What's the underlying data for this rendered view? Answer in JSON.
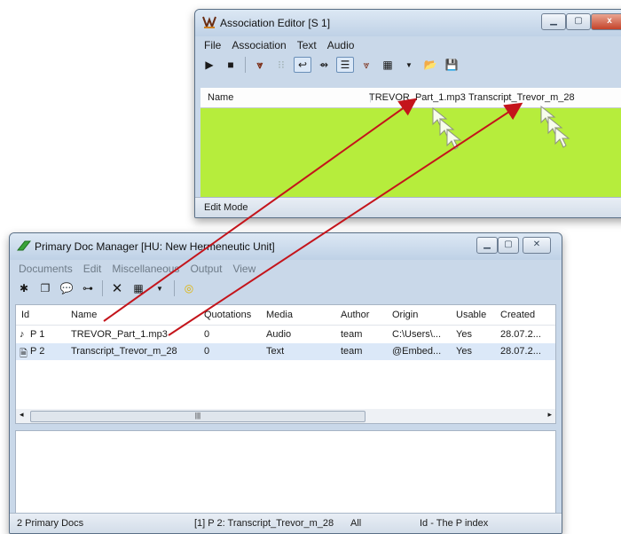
{
  "assoc": {
    "title": "Association Editor [S 1]",
    "menu": [
      "File",
      "Association",
      "Text",
      "Audio"
    ],
    "header": {
      "name": "Name",
      "col1": "TREVOR_Part_1.mp3",
      "col2": "Transcript_Trevor_m_28"
    },
    "status": "Edit Mode"
  },
  "pdm": {
    "title": "Primary Doc Manager [HU: New Hermeneutic Unit]",
    "menu": [
      "Documents",
      "Edit",
      "Miscellaneous",
      "Output",
      "View"
    ],
    "columns": [
      "Id",
      "Name",
      "Quotations",
      "Media",
      "Author",
      "Origin",
      "Usable",
      "Created"
    ],
    "rows": [
      {
        "id": "P 1",
        "name": "TREVOR_Part_1.mp3",
        "quotations": "0",
        "media": "Audio",
        "author": "team",
        "origin": "C:\\Users\\...",
        "usable": "Yes",
        "created": "28.07.2..."
      },
      {
        "id": "P 2",
        "name": "Transcript_Trevor_m_28",
        "quotations": "0",
        "media": "Text",
        "author": "team",
        "origin": "@Embed...",
        "usable": "Yes",
        "created": "28.07.2..."
      }
    ],
    "status": {
      "count": "2 Primary Docs",
      "selected": "[1] P 2: Transcript_Trevor_m_28",
      "filter": "All",
      "sort": "Id - The P index"
    }
  },
  "icons": {
    "accent_arrow": "#c4141b",
    "canvas_green": "#b6ed3c"
  }
}
